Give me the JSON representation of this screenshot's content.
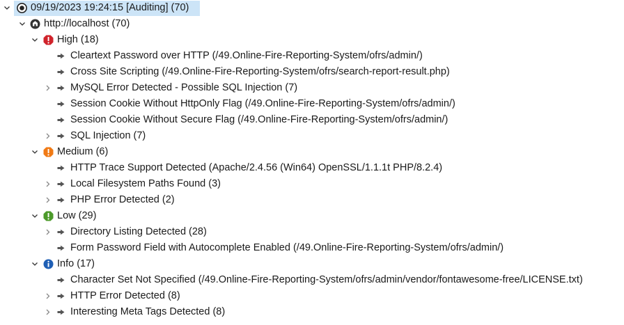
{
  "tree": {
    "scan": {
      "label": "09/19/2023 19:24:15 [Auditing]  (70)",
      "icon": "scan-target-icon"
    },
    "host": {
      "label": "http://localhost (70)",
      "icon": "host-globe-icon"
    },
    "groups": [
      {
        "label": "High (18)",
        "icon": "high-severity-icon",
        "color": "#d0232b",
        "items": [
          {
            "label": "Cleartext Password over HTTP (/49.Online-Fire-Reporting-System/ofrs/admin/)",
            "expandable": false
          },
          {
            "label": "Cross Site Scripting (/49.Online-Fire-Reporting-System/ofrs/search-report-result.php)",
            "expandable": false
          },
          {
            "label": "MySQL Error Detected - Possible SQL Injection (7)",
            "expandable": true
          },
          {
            "label": "Session Cookie Without HttpOnly Flag  (/49.Online-Fire-Reporting-System/ofrs/admin/)",
            "expandable": false
          },
          {
            "label": "Session Cookie Without Secure Flag  (/49.Online-Fire-Reporting-System/ofrs/admin/)",
            "expandable": false
          },
          {
            "label": "SQL Injection (7)",
            "expandable": true
          }
        ]
      },
      {
        "label": "Medium (6)",
        "icon": "medium-severity-icon",
        "color": "#f07a15",
        "items": [
          {
            "label": "HTTP Trace Support Detected (Apache/2.4.56 (Win64) OpenSSL/1.1.1t PHP/8.2.4)",
            "expandable": false
          },
          {
            "label": "Local Filesystem Paths Found (3)",
            "expandable": true
          },
          {
            "label": "PHP Error Detected (2)",
            "expandable": true
          }
        ]
      },
      {
        "label": "Low (29)",
        "icon": "low-severity-icon",
        "color": "#4c9a2a",
        "items": [
          {
            "label": "Directory Listing Detected (28)",
            "expandable": true
          },
          {
            "label": "Form Password Field with Autocomplete Enabled (/49.Online-Fire-Reporting-System/ofrs/admin/)",
            "expandable": false
          }
        ]
      },
      {
        "label": "Info (17)",
        "icon": "info-severity-icon",
        "color": "#1f5fb5",
        "items": [
          {
            "label": "Character Set Not Specified  (/49.Online-Fire-Reporting-System/ofrs/admin/vendor/fontawesome-free/LICENSE.txt)",
            "expandable": false
          },
          {
            "label": "HTTP Error Detected (8)",
            "expandable": true
          },
          {
            "label": "Interesting Meta Tags Detected (8)",
            "expandable": true
          }
        ]
      }
    ]
  }
}
